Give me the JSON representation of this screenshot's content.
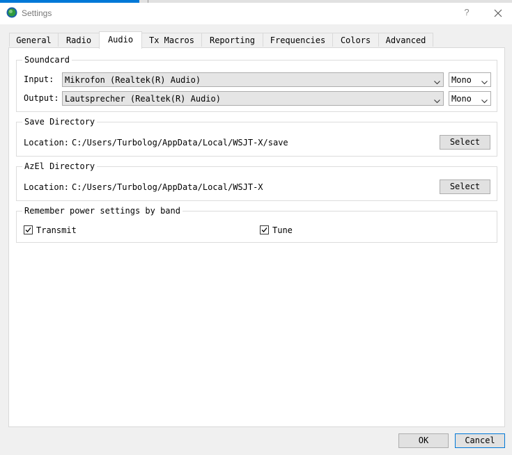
{
  "window": {
    "title": "Settings",
    "help_glyph": "?",
    "icon": "wsjt-app-icon"
  },
  "tabs": [
    {
      "label": "General"
    },
    {
      "label": "Radio"
    },
    {
      "label": "Audio"
    },
    {
      "label": "Tx Macros"
    },
    {
      "label": "Reporting"
    },
    {
      "label": "Frequencies"
    },
    {
      "label": "Colors"
    },
    {
      "label": "Advanced"
    }
  ],
  "active_tab": "Audio",
  "soundcard": {
    "title": "Soundcard",
    "input_label": "Input:",
    "input_value": "Mikrofon (Realtek(R) Audio)",
    "input_channel": "Mono",
    "output_label": "Output:",
    "output_value": "Lautsprecher (Realtek(R) Audio)",
    "output_channel": "Mono"
  },
  "save_directory": {
    "title": "Save Directory",
    "location_label": "Location:",
    "location_value": "C:/Users/Turbolog/AppData/Local/WSJT-X/save",
    "select_label": "Select"
  },
  "azel_directory": {
    "title": "AzEl Directory",
    "location_label": "Location:",
    "location_value": "C:/Users/Turbolog/AppData/Local/WSJT-X",
    "select_label": "Select"
  },
  "power_settings": {
    "title": "Remember power settings by band",
    "transmit_label": "Transmit",
    "transmit_checked": true,
    "tune_label": "Tune",
    "tune_checked": true
  },
  "footer": {
    "ok_label": "OK",
    "cancel_label": "Cancel"
  },
  "colors": {
    "accent": "#0078d7"
  }
}
